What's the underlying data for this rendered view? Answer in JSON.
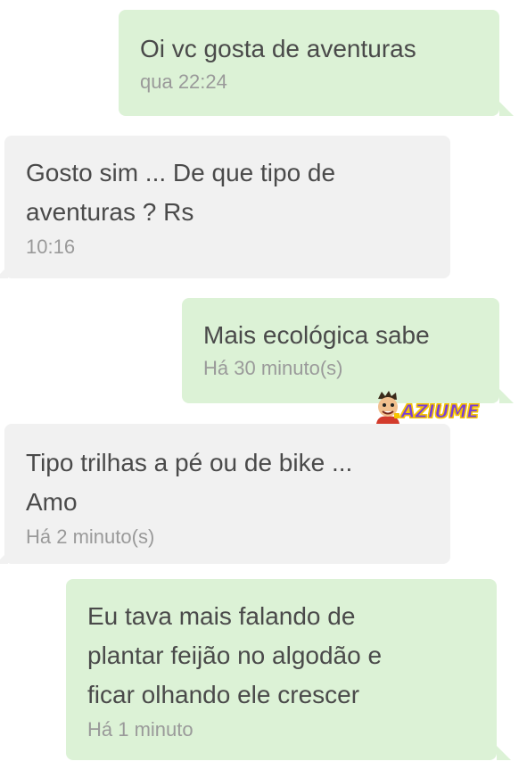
{
  "conversation": {
    "messages": [
      {
        "direction": "sent",
        "text": "Oi vc gosta de aventuras",
        "time": "qua  22:24"
      },
      {
        "direction": "received",
        "text": "Gosto sim ... De que tipo de\naventuras ? Rs",
        "time": "10:16"
      },
      {
        "direction": "sent",
        "text": "Mais ecológica sabe",
        "time": "Há 30 minuto(s)"
      },
      {
        "direction": "received",
        "text": "Tipo trilhas a pé ou de bike ...\nAmo",
        "time": "Há 2 minuto(s)"
      },
      {
        "direction": "sent",
        "text": "Eu tava mais falando de\nplantar feijão no algodão e\nficar olhando ele crescer",
        "time": "Há 1 minuto"
      }
    ]
  },
  "watermark": {
    "text": "AZIUME",
    "icon": "cartoon-face-icon"
  },
  "colors": {
    "sent_bubble": "#dcf2d6",
    "received_bubble": "#f1f1f1",
    "message_text": "#4a4a4a",
    "timestamp_text": "#9a9a9a",
    "watermark_text": "#7a3fd6",
    "watermark_outline": "#f6c500"
  }
}
